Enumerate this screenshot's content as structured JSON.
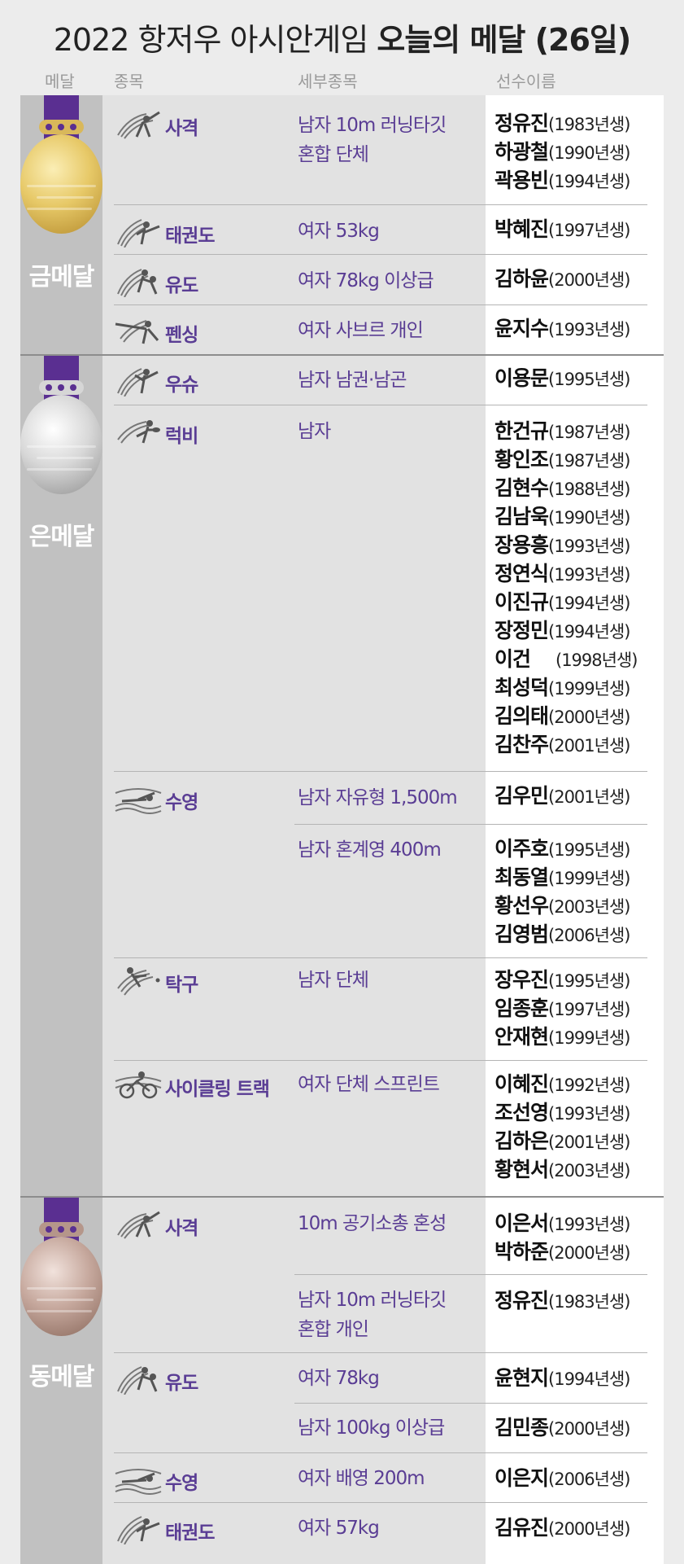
{
  "title": {
    "normal": "2022 항저우 아시안게임 ",
    "bold": "오늘의 메달 (26일)"
  },
  "headers": {
    "medal": "메달",
    "sport": "종목",
    "event": "세부종목",
    "athletes": "선수이름"
  },
  "colors": {
    "accent": "#5a3d94",
    "ribbon": "#5a2f91",
    "gold": "#d9b85a",
    "silver": "#c9c9c9",
    "bronze": "#b5968a"
  },
  "medals": {
    "gold": "금메달",
    "silver": "은메달",
    "bronze": "동메달"
  },
  "entries": [
    {
      "medal": "gold",
      "sport": "사격",
      "icon": "shooting-icon",
      "event": "남자 10m 러닝타깃\n혼합 단체",
      "athletes": [
        [
          "정유진",
          "(1983년생)"
        ],
        [
          "하광철",
          "(1990년생)"
        ],
        [
          "곽용빈",
          "(1994년생)"
        ]
      ]
    },
    {
      "medal": "gold",
      "sport": "태권도",
      "icon": "taekwondo-icon",
      "event": "여자 53kg",
      "athletes": [
        [
          "박혜진",
          "(1997년생)"
        ]
      ]
    },
    {
      "medal": "gold",
      "sport": "유도",
      "icon": "judo-icon",
      "event": "여자 78kg 이상급",
      "athletes": [
        [
          "김하윤",
          "(2000년생)"
        ]
      ]
    },
    {
      "medal": "gold",
      "sport": "펜싱",
      "icon": "fencing-icon",
      "event": "여자 사브르 개인",
      "athletes": [
        [
          "윤지수",
          "(1993년생)"
        ]
      ]
    },
    {
      "medal": "silver",
      "sport": "우슈",
      "icon": "wushu-icon",
      "event": "남자 남권·남곤",
      "athletes": [
        [
          "이용문",
          "(1995년생)"
        ]
      ]
    },
    {
      "medal": "silver",
      "sport": "럭비",
      "icon": "rugby-icon",
      "event": "남자",
      "athletes": [
        [
          "한건규",
          "(1987년생)"
        ],
        [
          "황인조",
          "(1987년생)"
        ],
        [
          "김현수",
          "(1988년생)"
        ],
        [
          "김남욱",
          "(1990년생)"
        ],
        [
          "장용흥",
          "(1993년생)"
        ],
        [
          "정연식",
          "(1993년생)"
        ],
        [
          "이진규",
          "(1994년생)"
        ],
        [
          "장정민",
          "(1994년생)"
        ],
        [
          "이건",
          "(1998년생)"
        ],
        [
          "최성덕",
          "(1999년생)"
        ],
        [
          "김의태",
          "(2000년생)"
        ],
        [
          "김찬주",
          "(2001년생)"
        ]
      ]
    },
    {
      "medal": "silver",
      "sport": "수영",
      "icon": "swimming-icon",
      "event": "남자 자유형 1,500m",
      "athletes": [
        [
          "김우민",
          "(2001년생)"
        ]
      ]
    },
    {
      "medal": "silver",
      "sport": "",
      "icon": "",
      "event": "남자 혼계영 400m",
      "athletes": [
        [
          "이주호",
          "(1995년생)"
        ],
        [
          "최동열",
          "(1999년생)"
        ],
        [
          "황선우",
          "(2003년생)"
        ],
        [
          "김영범",
          "(2006년생)"
        ]
      ]
    },
    {
      "medal": "silver",
      "sport": "탁구",
      "icon": "table-tennis-icon",
      "event": "남자 단체",
      "athletes": [
        [
          "장우진",
          "(1995년생)"
        ],
        [
          "임종훈",
          "(1997년생)"
        ],
        [
          "안재현",
          "(1999년생)"
        ]
      ]
    },
    {
      "medal": "silver",
      "sport": "사이클링 트랙",
      "icon": "cycling-icon",
      "event": "여자 단체 스프린트",
      "athletes": [
        [
          "이혜진",
          "(1992년생)"
        ],
        [
          "조선영",
          "(1993년생)"
        ],
        [
          "김하은",
          "(2001년생)"
        ],
        [
          "황현서",
          "(2003년생)"
        ]
      ]
    },
    {
      "medal": "bronze",
      "sport": "사격",
      "icon": "shooting-icon",
      "event": "10m 공기소총 혼성",
      "athletes": [
        [
          "이은서",
          "(1993년생)"
        ],
        [
          "박하준",
          "(2000년생)"
        ]
      ]
    },
    {
      "medal": "bronze",
      "sport": "",
      "icon": "",
      "event": "남자 10m 러닝타깃\n혼합 개인",
      "athletes": [
        [
          "정유진",
          "(1983년생)"
        ]
      ]
    },
    {
      "medal": "bronze",
      "sport": "유도",
      "icon": "judo-icon",
      "event": "여자 78kg",
      "athletes": [
        [
          "윤현지",
          "(1994년생)"
        ]
      ]
    },
    {
      "medal": "bronze",
      "sport": "",
      "icon": "",
      "event": "남자 100kg 이상급",
      "athletes": [
        [
          "김민종",
          "(2000년생)"
        ]
      ]
    },
    {
      "medal": "bronze",
      "sport": "수영",
      "icon": "swimming-icon",
      "event": "여자 배영 200m",
      "athletes": [
        [
          "이은지",
          "(2006년생)"
        ]
      ]
    },
    {
      "medal": "bronze",
      "sport": "태권도",
      "icon": "taekwondo-icon",
      "event": "여자 57kg",
      "athletes": [
        [
          "김유진",
          "(2000년생)"
        ]
      ]
    }
  ]
}
